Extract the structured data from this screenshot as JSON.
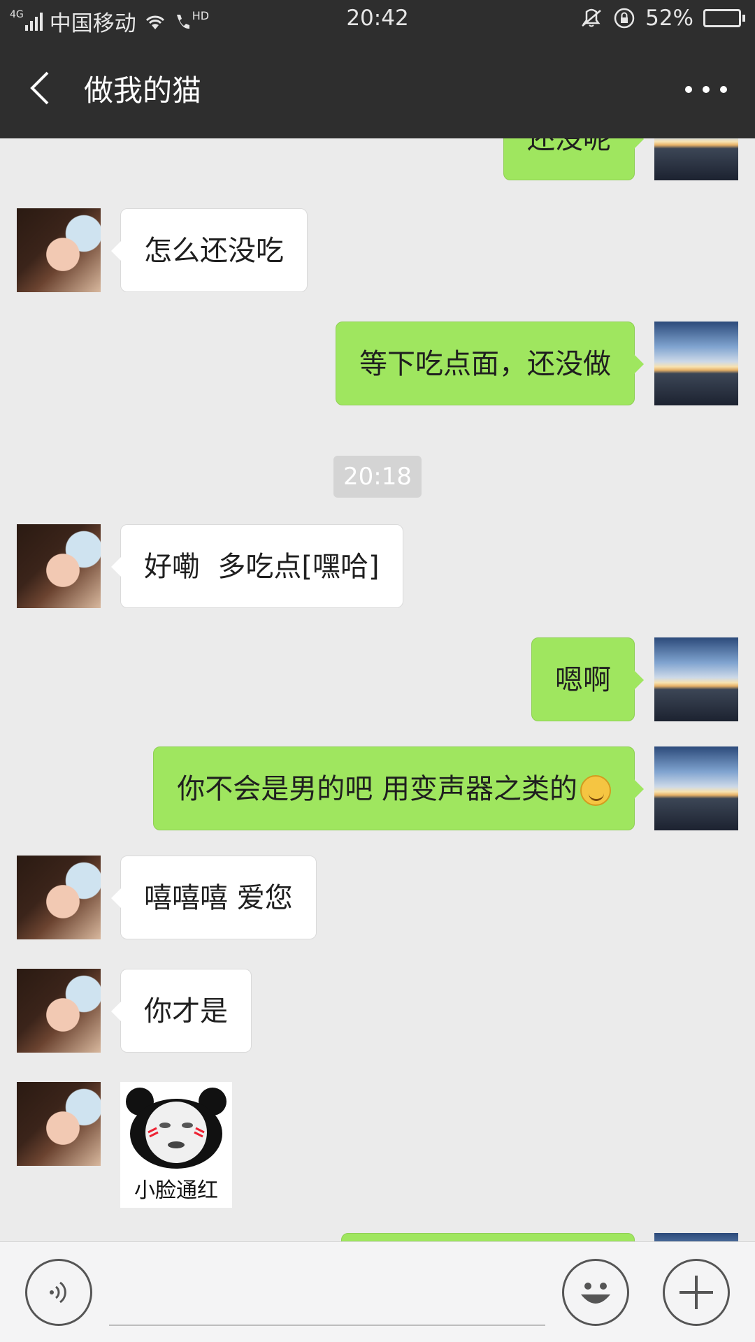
{
  "status_bar": {
    "network": "4G",
    "carrier": "中国移动",
    "hd_label": "HD",
    "time": "20:42",
    "battery_text": "52%",
    "battery_level": 0.52
  },
  "nav": {
    "title": "做我的猫"
  },
  "messages": [
    {
      "side": "right",
      "text": "还没呢"
    },
    {
      "side": "left",
      "text": "怎么还没吃"
    },
    {
      "side": "right",
      "text": "等下吃点面，还没做"
    },
    {
      "timestamp": "20:18"
    },
    {
      "side": "left",
      "text": "好嘞  多吃点[嘿哈]"
    },
    {
      "side": "right",
      "text": "嗯啊"
    },
    {
      "side": "right",
      "text": "你不会是男的吧 用变声器之类的",
      "emoji": "grinning-squint-emoji"
    },
    {
      "side": "left",
      "text": "嘻嘻嘻 爱您"
    },
    {
      "side": "left",
      "text": "你才是"
    },
    {
      "side": "left",
      "sticker_caption": "小脸通红"
    }
  ],
  "input_bar": {
    "voice_icon": "voice-icon",
    "emoji_icon": "smiley-icon",
    "plus_icon": "plus-icon"
  }
}
